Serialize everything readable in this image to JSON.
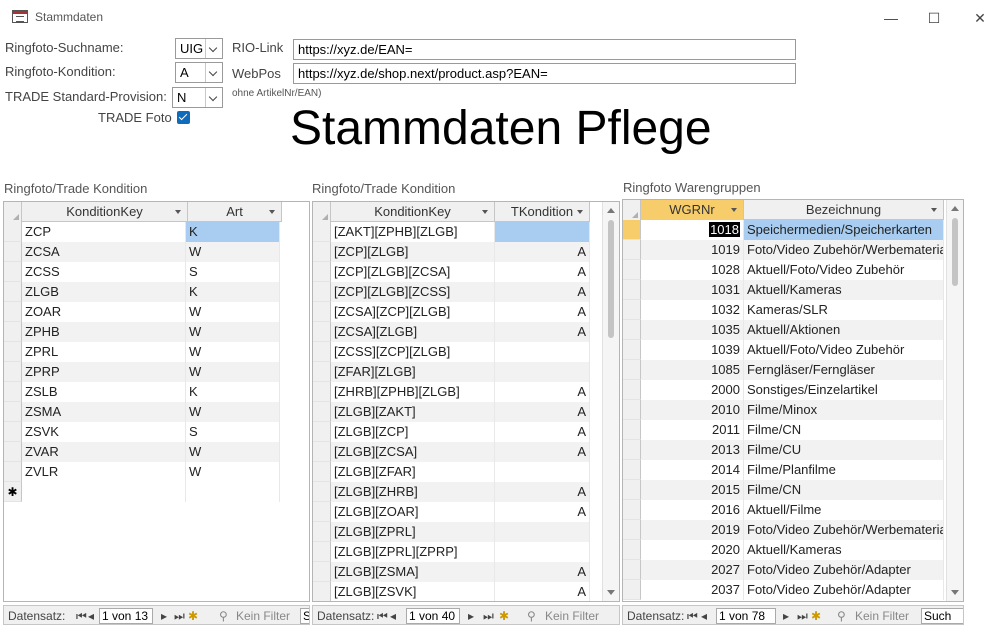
{
  "window": {
    "title": "Stammdaten"
  },
  "form": {
    "suchname_label": "Ringfoto-Suchname:",
    "suchname_value": "UIG",
    "kondition_label": "Ringfoto-Kondition:",
    "kondition_value": "A",
    "provision_label": "TRADE Standard-Provision:",
    "provision_value": "N",
    "tradefoto_label": "TRADE Foto",
    "tradefoto_checked": true,
    "rio_label": "RIO-Link",
    "rio_value": "https://xyz.de/EAN=",
    "webpos_label": "WebPos",
    "webpos_value": "https://xyz.de/shop.next/product.asp?EAN=",
    "hint": "ohne ArtikelNr/EAN)",
    "heading": "Stammdaten Pflege"
  },
  "grid1": {
    "caption": "Ringfoto/Trade Kondition",
    "columns": [
      "KonditionKey",
      "Art"
    ],
    "rows": [
      [
        "ZCP",
        "K"
      ],
      [
        "ZCSA",
        "W"
      ],
      [
        "ZCSS",
        "S"
      ],
      [
        "ZLGB",
        "K"
      ],
      [
        "ZOAR",
        "W"
      ],
      [
        "ZPHB",
        "W"
      ],
      [
        "ZPRL",
        "W"
      ],
      [
        "ZPRP",
        "W"
      ],
      [
        "ZSLB",
        "K"
      ],
      [
        "ZSMA",
        "W"
      ],
      [
        "ZSVK",
        "S"
      ],
      [
        "ZVAR",
        "W"
      ],
      [
        "ZVLR",
        "W"
      ]
    ],
    "nav": {
      "label": "Datensatz:",
      "position": "1 von 13",
      "filter": "Kein Filter",
      "search": "S"
    }
  },
  "grid2": {
    "caption": "Ringfoto/Trade Kondition",
    "columns": [
      "KonditionKey",
      "TKondition"
    ],
    "rows": [
      [
        "[ZAKT][ZPHB][ZLGB]",
        ""
      ],
      [
        "[ZCP][ZLGB]",
        "A"
      ],
      [
        "[ZCP][ZLGB][ZCSA]",
        "A"
      ],
      [
        "[ZCP][ZLGB][ZCSS]",
        "A"
      ],
      [
        "[ZCSA][ZCP][ZLGB]",
        "A"
      ],
      [
        "[ZCSA][ZLGB]",
        "A"
      ],
      [
        "[ZCSS][ZCP][ZLGB]",
        ""
      ],
      [
        "[ZFAR][ZLGB]",
        ""
      ],
      [
        "[ZHRB][ZPHB][ZLGB]",
        "A"
      ],
      [
        "[ZLGB][ZAKT]",
        "A"
      ],
      [
        "[ZLGB][ZCP]",
        "A"
      ],
      [
        "[ZLGB][ZCSA]",
        "A"
      ],
      [
        "[ZLGB][ZFAR]",
        ""
      ],
      [
        "[ZLGB][ZHRB]",
        "A"
      ],
      [
        "[ZLGB][ZOAR]",
        "A"
      ],
      [
        "[ZLGB][ZPRL]",
        ""
      ],
      [
        "[ZLGB][ZPRL][ZPRP]",
        ""
      ],
      [
        "[ZLGB][ZSMA]",
        "A"
      ],
      [
        "[ZLGB][ZSVK]",
        "A"
      ]
    ],
    "nav": {
      "label": "Datensatz:",
      "position": "1 von 40",
      "filter": "Kein Filter"
    }
  },
  "grid3": {
    "caption": "Ringfoto Warengruppen",
    "columns": [
      "WGRNr",
      "Bezeichnung"
    ],
    "rows": [
      [
        "1018",
        "Speichermedien/Speicherkarten"
      ],
      [
        "1019",
        "Foto/Video Zubehör/Werbematerial"
      ],
      [
        "1028",
        "Aktuell/Foto/Video Zubehör"
      ],
      [
        "1031",
        "Aktuell/Kameras"
      ],
      [
        "1032",
        "Kameras/SLR"
      ],
      [
        "1035",
        "Aktuell/Aktionen"
      ],
      [
        "1039",
        "Aktuell/Foto/Video Zubehör"
      ],
      [
        "1085",
        "Ferngläser/Ferngläser"
      ],
      [
        "2000",
        "Sonstiges/Einzelartikel"
      ],
      [
        "2010",
        "Filme/Minox"
      ],
      [
        "2011",
        "Filme/CN"
      ],
      [
        "2013",
        "Filme/CU"
      ],
      [
        "2014",
        "Filme/Planfilme"
      ],
      [
        "2015",
        "Filme/CN"
      ],
      [
        "2016",
        "Aktuell/Filme"
      ],
      [
        "2019",
        "Foto/Video Zubehör/Werbematerial"
      ],
      [
        "2020",
        "Aktuell/Kameras"
      ],
      [
        "2027",
        "Foto/Video Zubehör/Adapter"
      ],
      [
        "2037",
        "Foto/Video Zubehör/Adapter"
      ]
    ],
    "nav": {
      "label": "Datensatz:",
      "position": "1 von 78",
      "filter": "Kein Filter",
      "search": "Such"
    }
  }
}
